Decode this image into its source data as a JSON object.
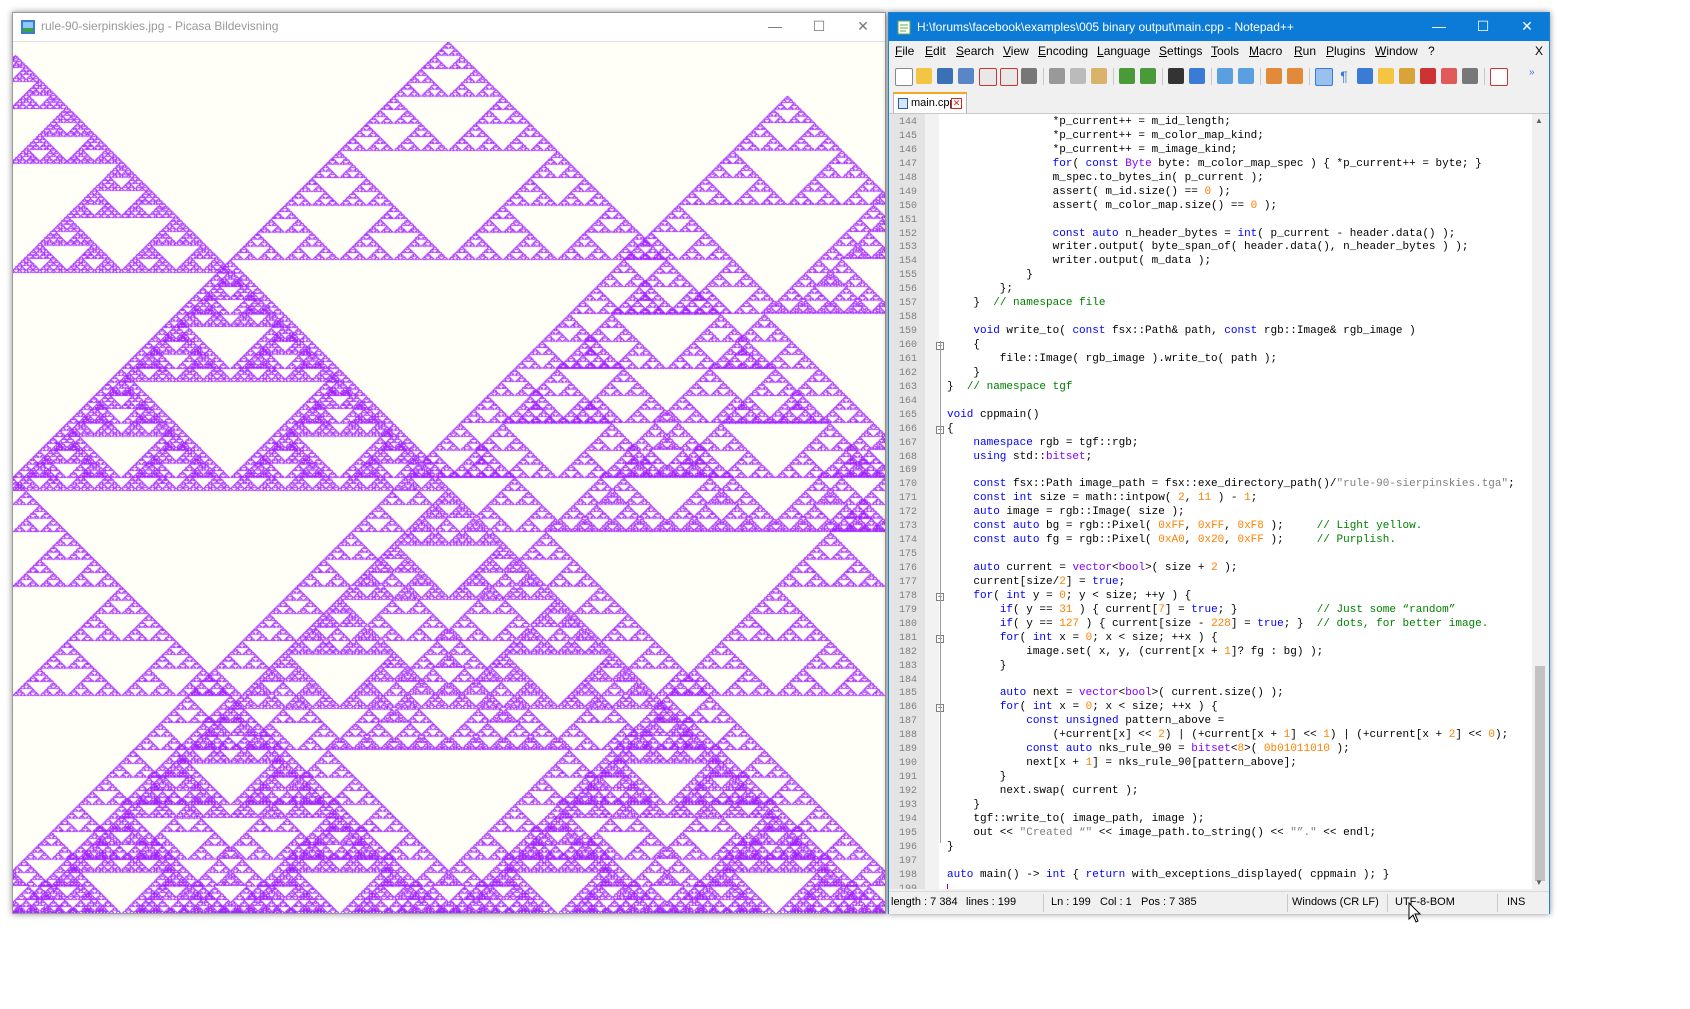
{
  "picasa": {
    "title": "rule-90-sierpinskies.jpg - Picasa Bildevisning",
    "fg_color": "#A020FF",
    "bg_color": "#FFFFF8"
  },
  "notepad": {
    "title": "H:\\forums\\facebook\\examples\\005 binary output\\main.cpp - Notepad++",
    "menu": [
      "File",
      "Edit",
      "Search",
      "View",
      "Encoding",
      "Language",
      "Settings",
      "Tools",
      "Macro",
      "Run",
      "Plugins",
      "Window",
      "?"
    ],
    "menu_close": "X",
    "tab_label": "main.cpp",
    "code_lines": [
      {
        "n": "144",
        "t": "                *p_current++ = m_id_length;"
      },
      {
        "n": "145",
        "t": "                *p_current++ = m_color_map_kind;"
      },
      {
        "n": "146",
        "t": "                *p_current++ = m_image_kind;"
      },
      {
        "n": "147",
        "t": "                for( const Byte byte: m_color_map_spec ) { *p_current++ = byte; }"
      },
      {
        "n": "148",
        "t": "                m_spec.to_bytes_in( p_current );"
      },
      {
        "n": "149",
        "t": "                assert( m_id.size() == 0 );"
      },
      {
        "n": "150",
        "t": "                assert( m_color_map.size() == 0 );"
      },
      {
        "n": "151",
        "t": ""
      },
      {
        "n": "152",
        "t": "                const auto n_header_bytes = int( p_current - header.data() );"
      },
      {
        "n": "153",
        "t": "                writer.output( byte_span_of( header.data(), n_header_bytes ) );"
      },
      {
        "n": "154",
        "t": "                writer.output( m_data );"
      },
      {
        "n": "155",
        "t": "            }"
      },
      {
        "n": "156",
        "t": "        };"
      },
      {
        "n": "157",
        "t": "    }  // namespace file"
      },
      {
        "n": "158",
        "t": ""
      },
      {
        "n": "159",
        "t": "    void write_to( const fsx::Path& path, const rgb::Image& rgb_image )"
      },
      {
        "n": "160",
        "t": "    {"
      },
      {
        "n": "161",
        "t": "        file::Image( rgb_image ).write_to( path );"
      },
      {
        "n": "162",
        "t": "    }"
      },
      {
        "n": "163",
        "t": "}  // namespace tgf"
      },
      {
        "n": "164",
        "t": ""
      },
      {
        "n": "165",
        "t": "void cppmain()"
      },
      {
        "n": "166",
        "t": "{"
      },
      {
        "n": "167",
        "t": "    namespace rgb = tgf::rgb;"
      },
      {
        "n": "168",
        "t": "    using std::bitset;"
      },
      {
        "n": "169",
        "t": ""
      },
      {
        "n": "170",
        "t": "    const fsx::Path image_path = fsx::exe_directory_path()/\"rule-90-sierpinskies.tga\";"
      },
      {
        "n": "171",
        "t": "    const int size = math::intpow( 2, 11 ) - 1;"
      },
      {
        "n": "172",
        "t": "    auto image = rgb::Image( size );"
      },
      {
        "n": "173",
        "t": "    const auto bg = rgb::Pixel( 0xFF, 0xFF, 0xF8 );     // Light yellow."
      },
      {
        "n": "174",
        "t": "    const auto fg = rgb::Pixel( 0xA0, 0x20, 0xFF );     // Purplish."
      },
      {
        "n": "175",
        "t": ""
      },
      {
        "n": "176",
        "t": "    auto current = vector<bool>( size + 2 );"
      },
      {
        "n": "177",
        "t": "    current[size/2] = true;"
      },
      {
        "n": "178",
        "t": "    for( int y = 0; y < size; ++y ) {"
      },
      {
        "n": "179",
        "t": "        if( y == 31 ) { current[7] = true; }            // Just some “random”"
      },
      {
        "n": "180",
        "t": "        if( y == 127 ) { current[size - 228] = true; }  // dots, for better image."
      },
      {
        "n": "181",
        "t": "        for( int x = 0; x < size; ++x ) {"
      },
      {
        "n": "182",
        "t": "            image.set( x, y, (current[x + 1]? fg : bg) );"
      },
      {
        "n": "183",
        "t": "        }"
      },
      {
        "n": "184",
        "t": ""
      },
      {
        "n": "185",
        "t": "        auto next = vector<bool>( current.size() );"
      },
      {
        "n": "186",
        "t": "        for( int x = 0; x < size; ++x ) {"
      },
      {
        "n": "187",
        "t": "            const unsigned pattern_above ="
      },
      {
        "n": "188",
        "t": "                (+current[x] << 2) | (+current[x + 1] << 1) | (+current[x + 2] << 0);"
      },
      {
        "n": "189",
        "t": "            const auto nks_rule_90 = bitset<8>( 0b01011010 );"
      },
      {
        "n": "190",
        "t": "            next[x + 1] = nks_rule_90[pattern_above];"
      },
      {
        "n": "191",
        "t": "        }"
      },
      {
        "n": "192",
        "t": "        next.swap( current );"
      },
      {
        "n": "193",
        "t": "    }"
      },
      {
        "n": "194",
        "t": "    tgf::write_to( image_path, image );"
      },
      {
        "n": "195",
        "t": "    out << \"Created “\" << image_path.to_string() << \"”.\" << endl;"
      },
      {
        "n": "196",
        "t": "}"
      },
      {
        "n": "197",
        "t": ""
      },
      {
        "n": "198",
        "t": "auto main() -> int { return with_exceptions_displayed( cppmain ); }"
      },
      {
        "n": "199",
        "t": ""
      }
    ],
    "fold_lines": [
      "160",
      "166",
      "178",
      "181",
      "186"
    ],
    "status": {
      "length": "length : 7 384",
      "lines": "lines : 199",
      "ln": "Ln : 199",
      "col": "Col : 1",
      "pos": "Pos : 7 385",
      "eol": "Windows (CR LF)",
      "encoding": "UTF-8-BOM",
      "mode": "INS"
    }
  }
}
